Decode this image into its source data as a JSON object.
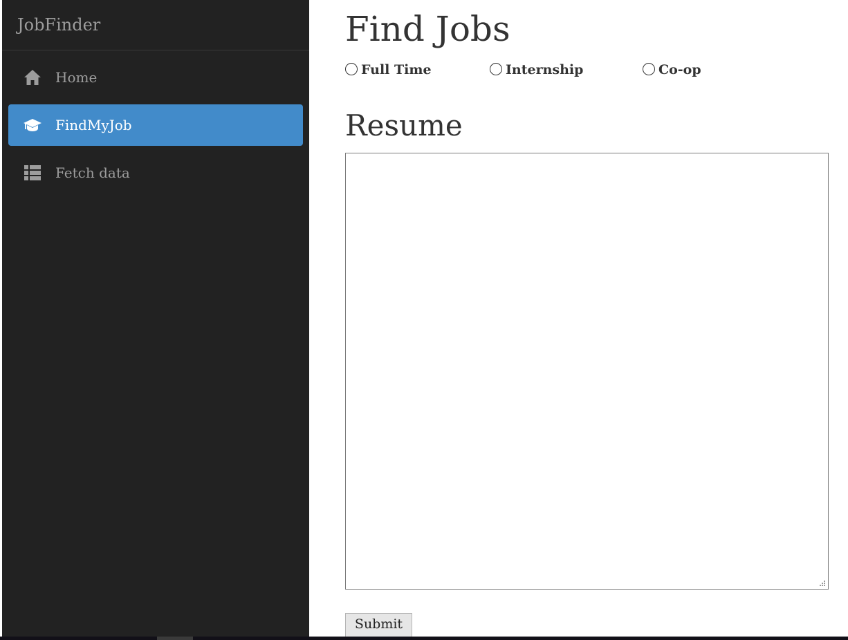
{
  "app": {
    "brand": "JobFinder"
  },
  "sidebar": {
    "items": [
      {
        "label": "Home",
        "icon": "home-icon",
        "active": false
      },
      {
        "label": "FindMyJob",
        "icon": "graduation-cap-icon",
        "active": true
      },
      {
        "label": "Fetch data",
        "icon": "list-icon",
        "active": false
      }
    ]
  },
  "main": {
    "title": "Find Jobs",
    "job_types": [
      {
        "label": "Full Time",
        "checked": false
      },
      {
        "label": "Internship",
        "checked": false
      },
      {
        "label": "Co-op",
        "checked": false
      }
    ],
    "resume_heading": "Resume",
    "resume_value": "",
    "submit_label": "Submit"
  },
  "colors": {
    "sidebar_bg": "#222222",
    "active_item": "#428bca",
    "nav_text": "#9d9d9d",
    "heading_text": "#333333"
  }
}
